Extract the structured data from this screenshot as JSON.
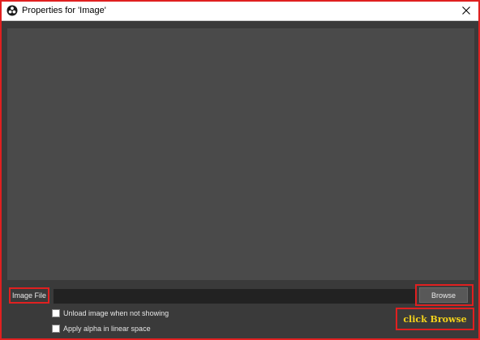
{
  "window": {
    "title": "Properties for 'Image'"
  },
  "icons": {
    "app": "obs-logo-icon",
    "close": "close-icon"
  },
  "property": {
    "label": "Image File",
    "value": "",
    "browse_label": "Browse"
  },
  "options": [
    {
      "label": "Unload image when not showing",
      "checked": false
    },
    {
      "label": "Apply alpha in linear space",
      "checked": false
    }
  ],
  "annotation": {
    "text": "click Browse"
  },
  "colors": {
    "highlight": "#e02020",
    "annotation_text": "#f3d21b",
    "background": "#3a3a3a",
    "preview": "#4a4a4a"
  }
}
